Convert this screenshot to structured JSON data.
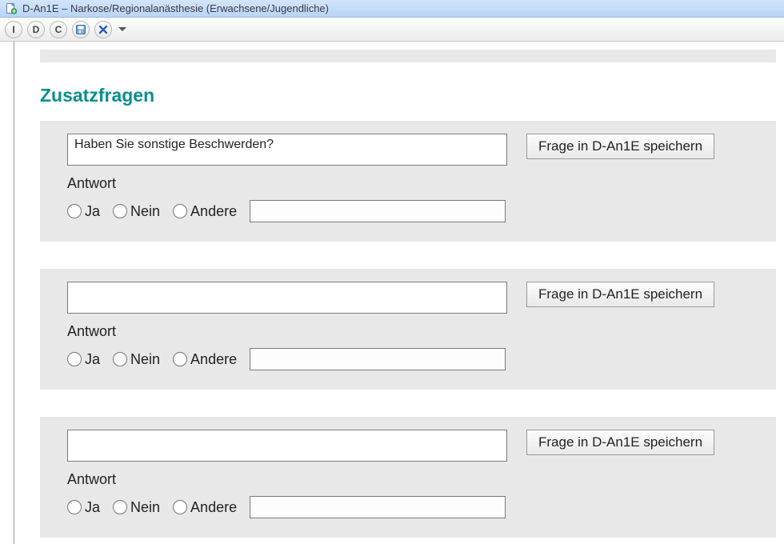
{
  "window": {
    "title": "D-An1E – Narkose/Regionalanästhesie (Erwachsene/Jugendliche)"
  },
  "toolbar": {
    "btn_i": "I",
    "btn_d": "D",
    "btn_c": "C",
    "save_icon": "save-icon",
    "delete_icon": "delete-icon",
    "chevron_icon": "chevron-down-icon"
  },
  "section_title": "Zusatzfragen",
  "labels": {
    "answer": "Antwort",
    "yes": "Ja",
    "no": "Nein",
    "other": "Andere",
    "save_question": "Frage in D-An1E speichern"
  },
  "questions": [
    {
      "text": "Haben Sie sonstige Beschwerden?",
      "other_value": ""
    },
    {
      "text": "",
      "other_value": ""
    },
    {
      "text": "",
      "other_value": ""
    }
  ]
}
